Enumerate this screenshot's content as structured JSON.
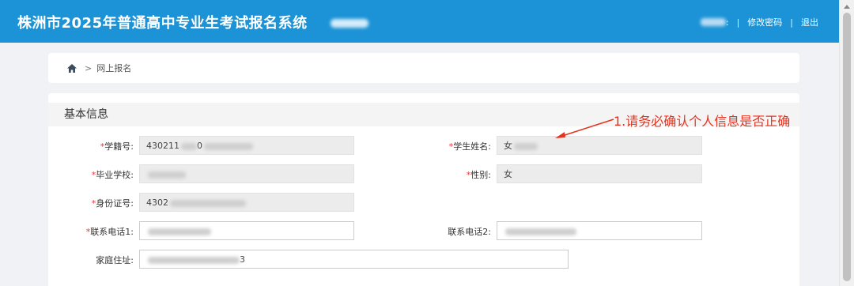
{
  "header": {
    "title": "株洲市2025年普通高中专业生考试报名系统",
    "user_suffix": ":",
    "separator": "|",
    "change_password": "修改密码",
    "logout": "退出"
  },
  "breadcrumb": {
    "separator": ">",
    "current": "网上报名"
  },
  "section": {
    "title": "基本信息"
  },
  "form": {
    "required_mark": "*",
    "student_id": {
      "label": "学籍号:",
      "value_prefix": "430211",
      "value_mid": "0"
    },
    "student_name": {
      "label": "学生姓名:",
      "value_prefix": "女"
    },
    "school": {
      "label": "毕业学校:",
      "value_prefix": ""
    },
    "gender": {
      "label": "性别:",
      "value": "女"
    },
    "id_number": {
      "label": "身份证号:",
      "value_prefix": "4302"
    },
    "phone1": {
      "label": "联系电话1:",
      "value_prefix": ""
    },
    "phone2": {
      "label": "联系电话2:",
      "value_prefix": ""
    },
    "address": {
      "label": "家庭住址:",
      "value_prefix": "",
      "value_suffix": "3"
    }
  },
  "annotation": {
    "text": "1.请务必确认个人信息是否正确",
    "color": "#e6331f"
  },
  "colors": {
    "header_bg": "#1b93d6",
    "required": "#e4393c"
  }
}
